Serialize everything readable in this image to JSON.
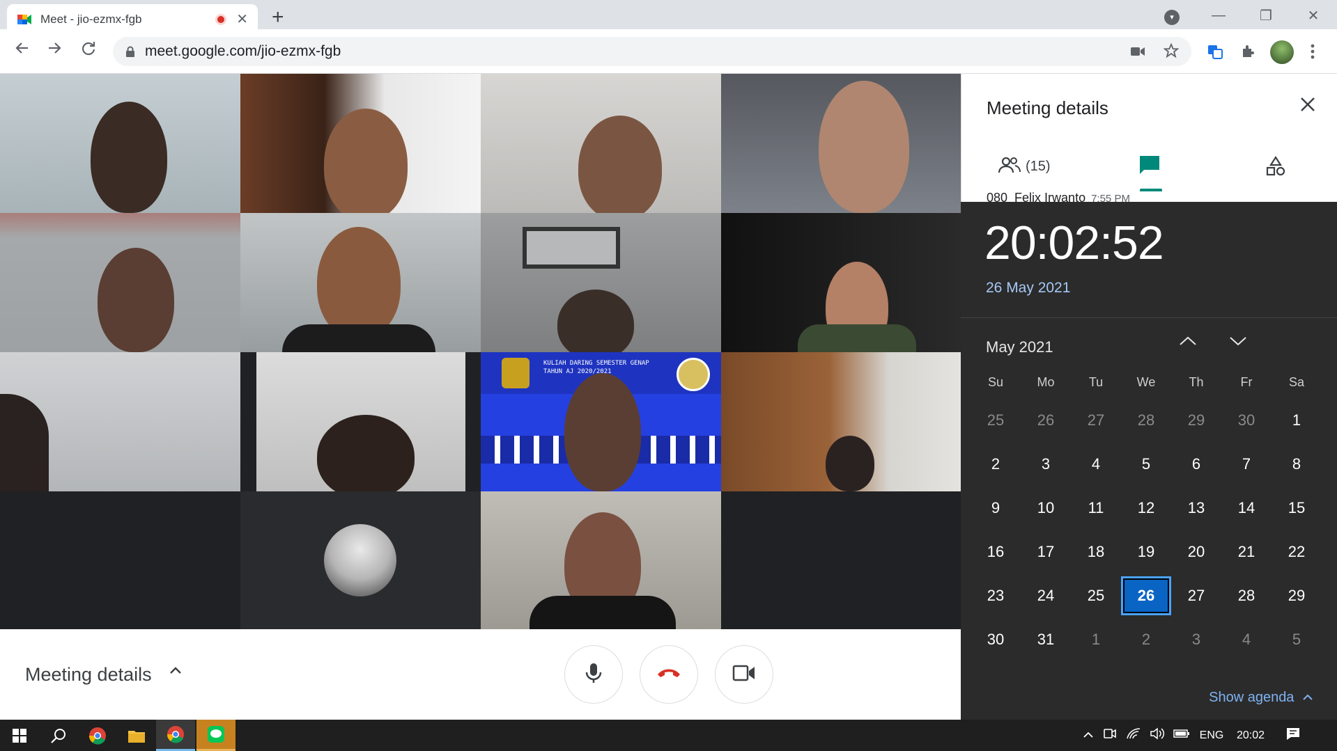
{
  "browser": {
    "tab_title": "Meet - jio-ezmx-fgb",
    "tab_close": "✕",
    "new_tab": "+",
    "url": "meet.google.com/jio-ezmx-fgb",
    "window_controls": [
      "—",
      "❐",
      "✕"
    ]
  },
  "meet": {
    "bottom_label": "Meeting details",
    "tiles": [
      {
        "id": "p01",
        "bg": "#b9c3c7"
      },
      {
        "id": "p02",
        "bg": "#5a3b2c"
      },
      {
        "id": "p03",
        "bg": "#c9c8c6"
      },
      {
        "id": "p04",
        "bg": "#6a6d73"
      },
      {
        "id": "p05",
        "bg": "#9fa3a6"
      },
      {
        "id": "p06",
        "bg": "#b3b7b9"
      },
      {
        "id": "p07",
        "bg": "#8f9192"
      },
      {
        "id": "p08",
        "bg": "#1b1b1b"
      },
      {
        "id": "p09",
        "bg": "#c7c9cb"
      },
      {
        "id": "p10",
        "bg": "#cfcfcf"
      },
      {
        "id": "p11",
        "bg": "#2540e0"
      },
      {
        "id": "p12",
        "bg": "#8a5a34"
      },
      {
        "id": "p13",
        "bg": "#202124"
      },
      {
        "id": "p14",
        "bg": "#2a2b2e"
      },
      {
        "id": "p15",
        "bg": "#b7b4ae"
      },
      {
        "id": "p16",
        "bg": "#202124"
      }
    ],
    "banner_text": "KULIAH DARING SEMESTER GENAP TAHUN AJ 2020/2021"
  },
  "side_panel": {
    "title": "Meeting details",
    "people_count": "(15)",
    "participant_name": "080_Felix Irwanto",
    "participant_time": "7:55 PM"
  },
  "clock_flyout": {
    "time": "20:02:52",
    "date": "26 May 2021",
    "month_label": "May 2021",
    "weekdays": [
      "Su",
      "Mo",
      "Tu",
      "We",
      "Th",
      "Fr",
      "Sa"
    ],
    "weeks": [
      [
        {
          "d": "25",
          "dim": true
        },
        {
          "d": "26",
          "dim": true
        },
        {
          "d": "27",
          "dim": true
        },
        {
          "d": "28",
          "dim": true
        },
        {
          "d": "29",
          "dim": true
        },
        {
          "d": "30",
          "dim": true
        },
        {
          "d": "1"
        }
      ],
      [
        {
          "d": "2"
        },
        {
          "d": "3"
        },
        {
          "d": "4"
        },
        {
          "d": "5"
        },
        {
          "d": "6"
        },
        {
          "d": "7"
        },
        {
          "d": "8"
        }
      ],
      [
        {
          "d": "9"
        },
        {
          "d": "10"
        },
        {
          "d": "11"
        },
        {
          "d": "12"
        },
        {
          "d": "13"
        },
        {
          "d": "14"
        },
        {
          "d": "15"
        }
      ],
      [
        {
          "d": "16"
        },
        {
          "d": "17"
        },
        {
          "d": "18"
        },
        {
          "d": "19"
        },
        {
          "d": "20"
        },
        {
          "d": "21"
        },
        {
          "d": "22"
        }
      ],
      [
        {
          "d": "23"
        },
        {
          "d": "24"
        },
        {
          "d": "25"
        },
        {
          "d": "26",
          "today": true
        },
        {
          "d": "27"
        },
        {
          "d": "28"
        },
        {
          "d": "29"
        }
      ],
      [
        {
          "d": "30"
        },
        {
          "d": "31"
        },
        {
          "d": "1",
          "dim": true
        },
        {
          "d": "2",
          "dim": true
        },
        {
          "d": "3",
          "dim": true
        },
        {
          "d": "4",
          "dim": true
        },
        {
          "d": "5",
          "dim": true
        }
      ]
    ],
    "show_agenda": "Show agenda"
  },
  "taskbar": {
    "language": "ENG",
    "time": "20:02"
  },
  "colors": {
    "meet_green": "#00897b",
    "hangup_red": "#d93025",
    "today_blue": "#0a64c4"
  }
}
